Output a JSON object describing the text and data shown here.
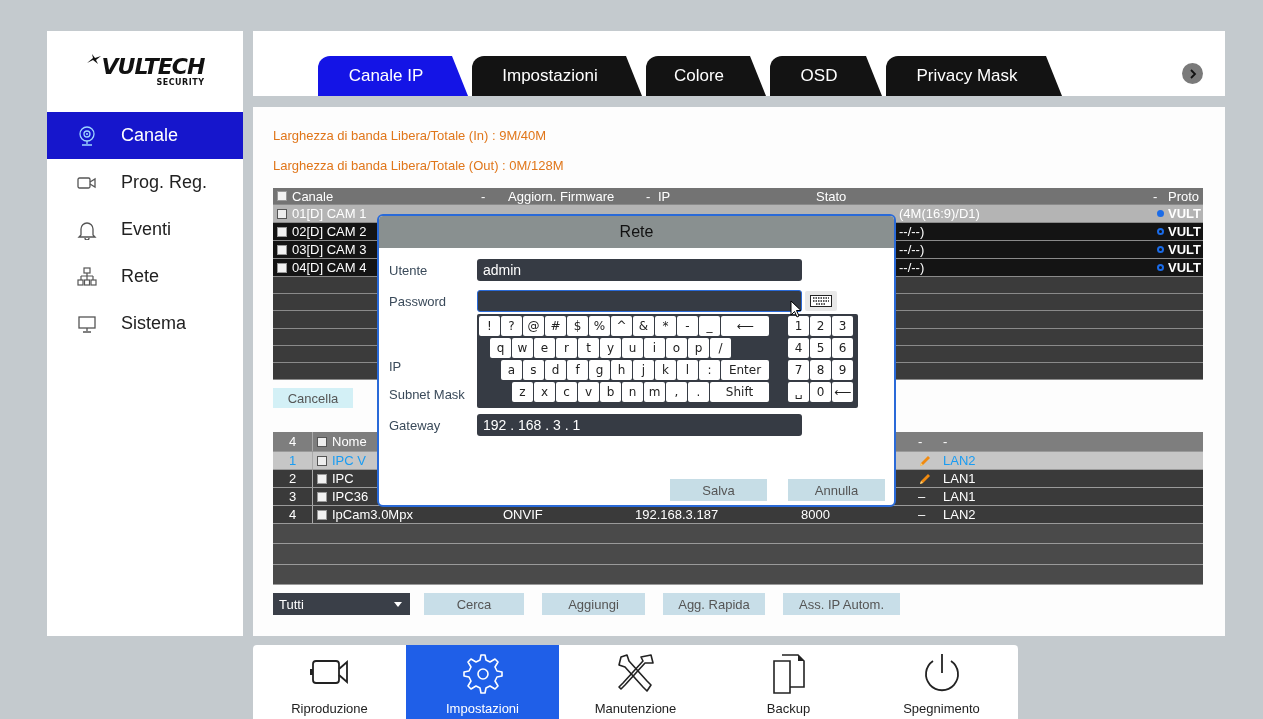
{
  "sidebar": {
    "logo": "VULTECH",
    "logo_sub": "SECURITY",
    "items": [
      {
        "label": "Canale",
        "selected": true
      },
      {
        "label": "Prog. Reg.",
        "selected": false
      },
      {
        "label": "Eventi",
        "selected": false
      },
      {
        "label": "Rete",
        "selected": false
      },
      {
        "label": "Sistema",
        "selected": false
      }
    ]
  },
  "tabs": [
    {
      "label": "Canale IP",
      "selected": true
    },
    {
      "label": "Impostazioni",
      "selected": false
    },
    {
      "label": "Colore",
      "selected": false
    },
    {
      "label": "OSD",
      "selected": false
    },
    {
      "label": "Privacy Mask",
      "selected": false
    }
  ],
  "bandwidth": [
    "Larghezza di banda Libera/Totale (In) : 9M/40M",
    "Larghezza di banda Libera/Totale (Out) : 0M/128M"
  ],
  "channel_table": {
    "header": {
      "checked": false,
      "columns": [
        "Canale",
        "-",
        "Aggiorn. Firmware",
        "-",
        "IP",
        "Stato",
        "-",
        "Proto"
      ]
    },
    "rows": [
      {
        "channel": "01[D] CAM 1",
        "status": "(4M(16:9)/D1)",
        "online": true,
        "protocol": "VULT",
        "selected": true,
        "checked": false
      },
      {
        "channel": "02[D] CAM 2",
        "status": "--/--)",
        "online": false,
        "protocol": "VULT",
        "selected": false,
        "checked": false
      },
      {
        "channel": "03[D] CAM 3",
        "status": "--/--)",
        "online": false,
        "protocol": "VULT",
        "selected": false,
        "checked": false
      },
      {
        "channel": "04[D] CAM 4",
        "status": "--/--)",
        "online": false,
        "protocol": "VULT",
        "selected": false,
        "checked": false
      }
    ]
  },
  "delete_button": "Cancella",
  "device_table": {
    "header": {
      "count": "4",
      "checked": false,
      "name": "Nome",
      "column_6": "-",
      "column_7": "-"
    },
    "rows": [
      {
        "number": "1",
        "name": "IPC V",
        "edit_icon": true,
        "port": "LAN2",
        "selected": true,
        "checked": false
      },
      {
        "number": "2",
        "name": "IPC",
        "edit_icon": true,
        "port": "LAN1",
        "selected": false,
        "checked": false
      },
      {
        "number": "3",
        "name": "IPC36",
        "edit_icon": false,
        "mark": "–",
        "port": "LAN1",
        "selected": false,
        "checked": false
      },
      {
        "number": "4",
        "name": "IpCam3.0Mpx",
        "protocol": "ONVIF",
        "ip": "192.168.3.187",
        "tcp_port": "8000",
        "edit_icon": false,
        "mark": "–",
        "port": "LAN2",
        "selected": false,
        "checked": false
      }
    ]
  },
  "filter": {
    "value": "Tutti"
  },
  "buttons": [
    "Cerca",
    "Aggiungi",
    "Agg. Rapida",
    "Ass. IP Autom."
  ],
  "dock": [
    {
      "label": "Riproduzione",
      "selected": false
    },
    {
      "label": "Impostazioni",
      "selected": true
    },
    {
      "label": "Manutenzione",
      "selected": false
    },
    {
      "label": "Backup",
      "selected": false
    },
    {
      "label": "Spegnimento",
      "selected": false
    }
  ],
  "dialog": {
    "title": "Rete",
    "fields": [
      {
        "label": "Utente",
        "value": "admin",
        "focused": false
      },
      {
        "label": "Password",
        "focused": true
      },
      {
        "label": "IP"
      },
      {
        "label": "Subnet Mask"
      },
      {
        "label": "Gateway",
        "value": "192 . 168 . 3 . 1",
        "focused": false
      }
    ],
    "keyboard": {
      "rows": [
        {
          "keys": [
            "!",
            "?",
            "@",
            "#",
            "$",
            "%",
            "^",
            "&",
            "*",
            "-",
            "_",
            "⟵"
          ],
          "wide_last": true
        },
        {
          "keys": [
            "q",
            "w",
            "e",
            "r",
            "t",
            "y",
            "u",
            "i",
            "o",
            "p",
            "/"
          ],
          "wide_last": false
        },
        {
          "keys": [
            "a",
            "s",
            "d",
            "f",
            "g",
            "h",
            "j",
            "k",
            "l",
            ":",
            "Enter"
          ],
          "wide_last": true
        },
        {
          "keys": [
            "z",
            "x",
            "c",
            "v",
            "b",
            "n",
            "m",
            ",",
            ".",
            "Shift"
          ],
          "wide_last": true
        }
      ],
      "numpad": [
        [
          "1",
          "2",
          "3"
        ],
        [
          "4",
          "5",
          "6"
        ],
        [
          "7",
          "8",
          "9"
        ],
        [
          "␣",
          "0",
          "⟵"
        ]
      ]
    },
    "buttons": [
      "Salva",
      "Annulla"
    ]
  }
}
